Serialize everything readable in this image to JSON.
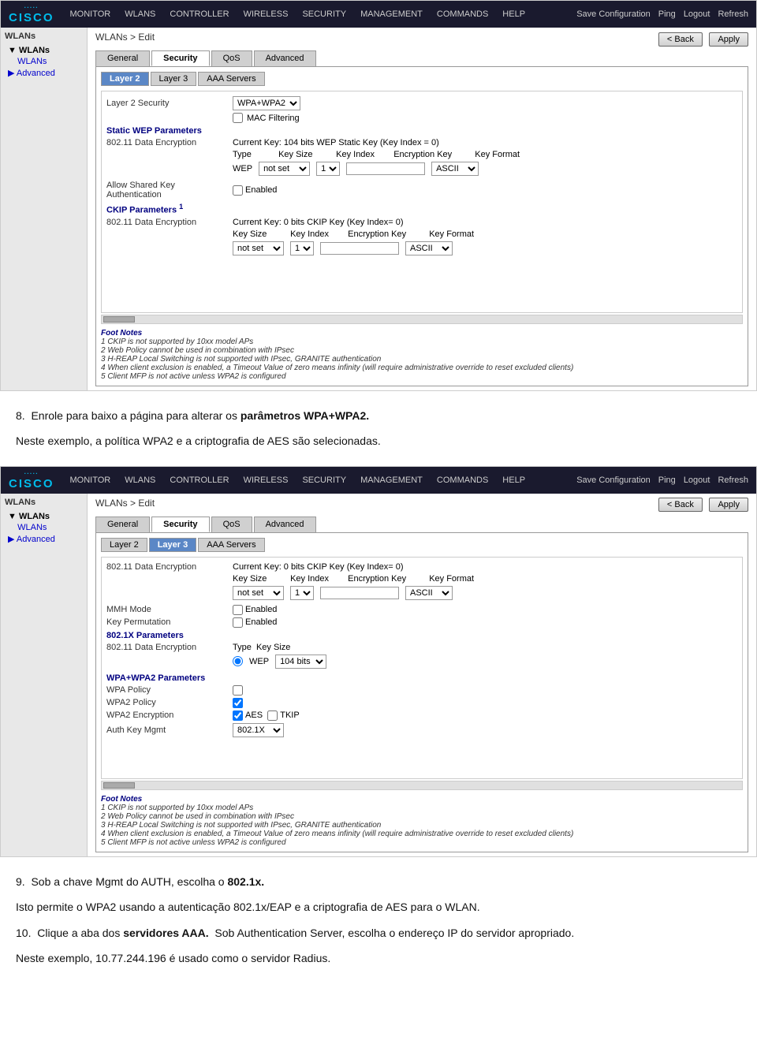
{
  "screenshots": {
    "first": {
      "header": {
        "topLinks": [
          "Save Configuration",
          "Ping",
          "Logout",
          "Refresh"
        ],
        "navItems": [
          "MONITOR",
          "WLANs",
          "CONTROLLER",
          "WIRELESS",
          "SECURITY",
          "MANAGEMENT",
          "COMMANDS",
          "HELP"
        ]
      },
      "breadcrumb": "WLANs > Edit",
      "buttons": {
        "back": "< Back",
        "apply": "Apply"
      },
      "tabs": [
        "General",
        "Security",
        "QoS",
        "Advanced"
      ],
      "activeTab": "Security",
      "subtabs": [
        "Layer 2",
        "Layer 3",
        "AAA Servers"
      ],
      "activeSubtab": "Layer 2",
      "layer2": {
        "securityLabel": "Layer 2 Security",
        "securityValue": "WPA+WPA2",
        "macFiltering": "MAC Filtering",
        "staticWEPSection": "Static WEP Parameters",
        "ckipSection": "CKIP Parameters",
        "encryption80211Label": "802.11 Data Encryption",
        "currentKeyLabel": "Current Key:",
        "currentKeyValue": "104 bits WEP Static Key (Key Index = 0)",
        "typeLabel": "Type",
        "keySizeLabel": "Key Size",
        "keyIndexLabel": "Key Index",
        "encryptionKeyLabel": "Encryption Key",
        "keyFormatLabel": "Key Format",
        "typeValue": "WEP",
        "keySizeValue": "not set",
        "keyIndexValue": "1",
        "keyFormatValue": "ASCII",
        "allowSharedKey": "Allow Shared Key Authentication",
        "enabledLabel": "Enabled",
        "ckipEncryptionLabel": "802.11 Data Encryption",
        "ckipCurrentKey": "Current Key: 0 bits CKIP Key (Key Index= 0)",
        "ckipKeySizeLabel": "Key Size",
        "ckipKeyIndexLabel": "Key Index",
        "ckipEncKeyLabel": "Encryption Key",
        "ckipKeyFormatLabel": "Key Format",
        "ckipKeySizeValue": "not set",
        "ckipKeyIndexValue": "1",
        "ckipKeyFormatValue": "ASCII"
      },
      "footNotes": {
        "title": "Foot Notes",
        "notes": [
          "1 CKIP is not supported by 10xx model APs",
          "2 Web Policy cannot be used in combination with IPsec",
          "3 H-REAP Local Switching is not supported with IPsec, GRANITE authentication",
          "4 When client exclusion is enabled, a Timeout Value of zero means infinity (will require administrative override to reset excluded clients)",
          "5 Client MFP is not active unless WPA2 is configured"
        ]
      }
    },
    "second": {
      "header": {
        "topLinks": [
          "Save Configuration",
          "Ping",
          "Logout",
          "Refresh"
        ],
        "navItems": [
          "MONITOR",
          "WLANs",
          "CONTROLLER",
          "WIRELESS",
          "SECURITY",
          "MANAGEMENT",
          "COMMANDS",
          "HELP"
        ]
      },
      "breadcrumb": "WLANs > Edit",
      "buttons": {
        "back": "< Back",
        "apply": "Apply"
      },
      "tabs": [
        "General",
        "Security",
        "QoS",
        "Advanced"
      ],
      "activeTab": "Security",
      "subtabs": [
        "Layer 2",
        "Layer 3",
        "AAA Servers"
      ],
      "activeSubtab": "Layer 3",
      "layer3": {
        "ckip80211Label": "802.11 Data Encryption",
        "ckipCurrentKey": "Current Key: 0 bits CKIP Key (Key Index= 0)",
        "ckipKeySizeLabel": "Key Size",
        "ckipKeyIndexLabel": "Key Index",
        "ckipEncKeyLabel": "Encryption Key",
        "ckipKeyFormatLabel": "Key Format",
        "ckipKeySizeValue": "not set",
        "ckipKeyIndexValue": "1",
        "ckipKeyFormatValue": "ASCII",
        "mmhModeLabel": "MMH Mode",
        "keyPermutationLabel": "Key Permutation",
        "enabled": "Enabled",
        "dot1xSection": "802.1X Parameters",
        "dot1xEncLabel": "802.11 Data Encryption",
        "dot1xTypeLabel": "Type",
        "dot1xKeySizeLabel": "Key Size",
        "dot1xTypeValue": "WEP",
        "dot1xKeySizeValue": "104 bits",
        "wpaSection": "WPA+WPA2 Parameters",
        "wpaPolicyLabel": "WPA Policy",
        "wpa2PolicyLabel": "WPA2 Policy",
        "wpa2EncryptionLabel": "WPA2 Encryption",
        "authKeyMgmtLabel": "Auth Key Mgmt",
        "wpa2EncAES": "AES",
        "wpa2EncTKIP": "TKIP",
        "authKeyMgmtValue": "802.1X"
      },
      "footNotes": {
        "title": "Foot Notes",
        "notes": [
          "1 CKIP is not supported by 10xx model APs",
          "2 Web Policy cannot be used in combination with IPsec",
          "3 H-REAP Local Switching is not supported with IPsec, GRANITE authentication",
          "4 When client exclusion is enabled, a Timeout Value of zero means infinity (will require administrative override to reset excluded clients)",
          "5 Client MFP is not active unless WPA2 is configured"
        ]
      }
    }
  },
  "prose": {
    "step8": "8.",
    "step8text": "Enrole para baixo a página para alterar os",
    "step8bold": "parâmetros WPA+WPA2.",
    "step8b": "Neste exemplo, a política WPA2 e a criptografia de AES são selecionadas.",
    "step9": "9.",
    "step9text": "Sob a chave Mgmt do AUTH, escolha o",
    "step9bold": "802.1x.",
    "step9b": "Isto permite o WPA2 usando a autenticação 802.1x/EAP e a criptografia de AES para o WLAN.",
    "step10": "10.",
    "step10text": "Clique a aba dos",
    "step10bold": "servidores AAA.",
    "step10b": "Sob Authentication Server, escolha o endereço IP do servidor apropriado.",
    "step10c": "Neste exemplo, 10.77.244.196 é usado como o servidor Radius."
  }
}
